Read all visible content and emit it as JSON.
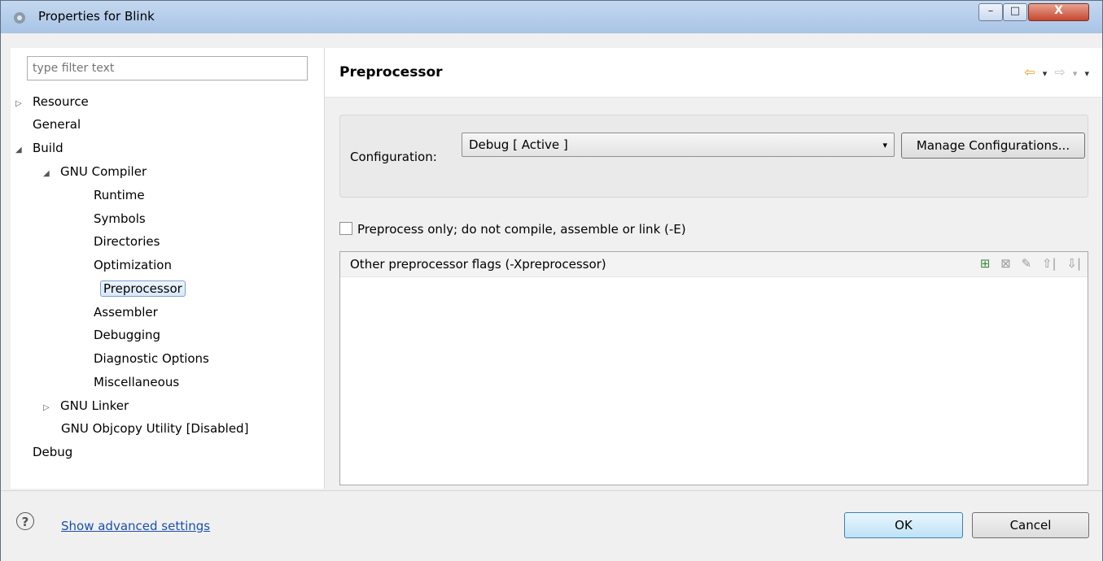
{
  "window": {
    "title": "Properties for Blink",
    "min_glyph": "–",
    "max_glyph": "□",
    "close_glyph": "X"
  },
  "filter": {
    "placeholder": "type filter text"
  },
  "tree": [
    {
      "label": "Resource",
      "arrow": "▷"
    },
    {
      "label": "General",
      "arrow": ""
    },
    {
      "label": "Build",
      "arrow": "◢"
    },
    {
      "label": "GNU Compiler",
      "arrow": "◢"
    },
    {
      "label": "Runtime",
      "arrow": ""
    },
    {
      "label": "Symbols",
      "arrow": ""
    },
    {
      "label": "Directories",
      "arrow": ""
    },
    {
      "label": "Optimization",
      "arrow": ""
    },
    {
      "label": "Preprocessor",
      "arrow": "",
      "selected": true
    },
    {
      "label": "Assembler",
      "arrow": ""
    },
    {
      "label": "Debugging",
      "arrow": ""
    },
    {
      "label": "Diagnostic Options",
      "arrow": ""
    },
    {
      "label": "Miscellaneous",
      "arrow": ""
    },
    {
      "label": "GNU Linker",
      "arrow": "▷"
    },
    {
      "label": "GNU Objcopy Utility  [Disabled]",
      "arrow": ""
    },
    {
      "label": "Debug",
      "arrow": ""
    }
  ],
  "page": {
    "title": "Preprocessor",
    "nav": {
      "back": "⇦",
      "back_dropdown": "▾",
      "forward": "⇨",
      "forward_dropdown": "▾",
      "menu": "▾"
    },
    "config_label": "Configuration:",
    "config_value": "Debug  [ Active ]",
    "config_caret": "▾",
    "manage_button": "Manage Configurations...",
    "preprocess_only_label": "Preprocess only; do not compile, assemble or link (-E)",
    "preprocess_only_checked": false,
    "flags_title": "Other preprocessor flags (-Xpreprocessor)",
    "flags_tools": [
      "add",
      "delete",
      "edit",
      "move-up",
      "move-down"
    ]
  },
  "footer": {
    "help_glyph": "?",
    "advanced_link": "Show advanced settings",
    "ok": "OK",
    "cancel": "Cancel"
  }
}
